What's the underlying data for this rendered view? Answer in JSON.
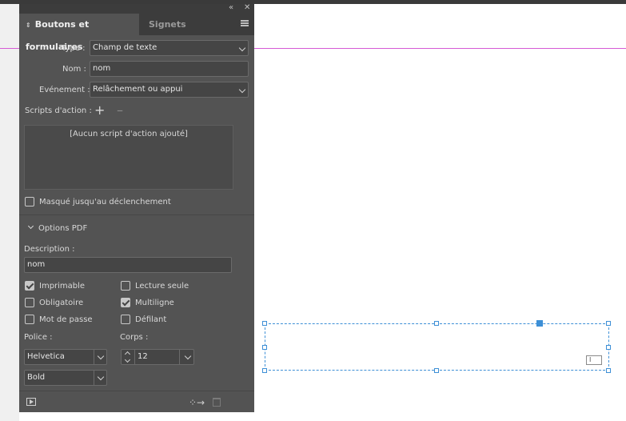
{
  "colors": {
    "panel": "#535353",
    "selection": "#3d8fd6",
    "guide": "#d65ad6"
  },
  "tabs": {
    "active": "Boutons et formulaires",
    "inactive": "Signets"
  },
  "titlebar": {
    "collapse_icon": "double-chevron-icon",
    "close_icon": "close-icon",
    "menu_icon": "panel-menu-icon"
  },
  "type": {
    "label": "Type :",
    "value": "Champ de texte"
  },
  "name": {
    "label": "Nom :",
    "value": "nom"
  },
  "event": {
    "label": "Evénement :",
    "value": "Relâchement ou appui"
  },
  "scripts": {
    "label": "Scripts d'action :",
    "add": "+",
    "remove": "–",
    "empty_text": "[Aucun script d'action ajouté]"
  },
  "hidden_until": {
    "label": "Masqué jusqu'au déclenchement",
    "checked": false
  },
  "pdf_options": {
    "header": "Options PDF",
    "description_label": "Description :",
    "description_value": "nom",
    "checkboxes": [
      {
        "label": "Imprimable",
        "checked": true
      },
      {
        "label": "Lecture seule",
        "checked": false
      },
      {
        "label": "Obligatoire",
        "checked": false
      },
      {
        "label": "Multiligne",
        "checked": true
      },
      {
        "label": "Mot de passe",
        "checked": false
      },
      {
        "label": "Défilant",
        "checked": false
      }
    ],
    "font_label": "Police :",
    "font_value": "Helvetica",
    "style_value": "Bold",
    "size_label": "Corps :",
    "size_value": "12"
  },
  "footer": {
    "preview_icon": "preview-icon",
    "convert_icon": "convert-to-button-icon",
    "delete_icon": "trash-icon"
  },
  "canvas": {
    "field_badge": "I"
  }
}
